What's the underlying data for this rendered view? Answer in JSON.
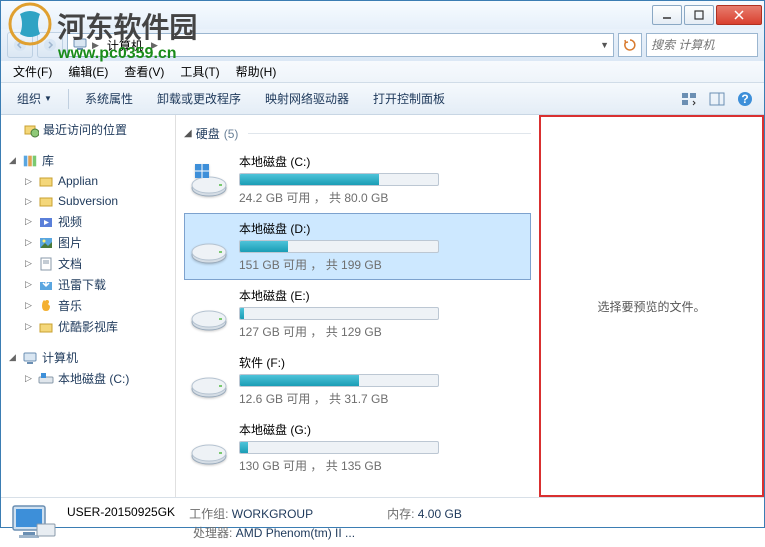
{
  "watermark": {
    "text": "河东软件园",
    "url": "www.pc0359.cn"
  },
  "address": {
    "crumb": "计算机",
    "sep": "▶"
  },
  "search": {
    "placeholder": "搜索 计算机"
  },
  "menu": {
    "file": "文件(F)",
    "edit": "编辑(E)",
    "view": "查看(V)",
    "tools": "工具(T)",
    "help": "帮助(H)"
  },
  "toolbar": {
    "organize": "组织",
    "sysprops": "系统属性",
    "uninstall": "卸载或更改程序",
    "mapdrive": "映射网络驱动器",
    "ctrlpanel": "打开控制面板"
  },
  "sidebar": {
    "recent": "最近访问的位置",
    "lib": "库",
    "items": [
      "Applian",
      "Subversion",
      "视频",
      "图片",
      "文档",
      "迅雷下载",
      "音乐",
      "优酷影视库"
    ],
    "computer": "计算机",
    "localc": "本地磁盘 (C:)"
  },
  "group": {
    "name": "硬盘",
    "count": "(5)"
  },
  "drives": [
    {
      "name": "本地磁盘 (C:)",
      "free": "24.2 GB 可用 ， 共 80.0 GB",
      "pct": 70,
      "type": "win"
    },
    {
      "name": "本地磁盘 (D:)",
      "free": "151 GB 可用 ， 共 199 GB",
      "pct": 24,
      "sel": true
    },
    {
      "name": "本地磁盘 (E:)",
      "free": "127 GB 可用 ， 共 129 GB",
      "pct": 2
    },
    {
      "name": "软件 (F:)",
      "free": "12.6 GB 可用 ， 共 31.7 GB",
      "pct": 60
    },
    {
      "name": "本地磁盘 (G:)",
      "free": "130 GB 可用 ， 共 135 GB",
      "pct": 4
    }
  ],
  "preview": {
    "text": "选择要预览的文件。"
  },
  "status": {
    "name": "USER-20150925GK",
    "wg_label": "工作组:",
    "wg": "WORKGROUP",
    "mem_label": "内存:",
    "mem": "4.00 GB",
    "cpu_label": "处理器:",
    "cpu": "AMD Phenom(tm) II ..."
  }
}
